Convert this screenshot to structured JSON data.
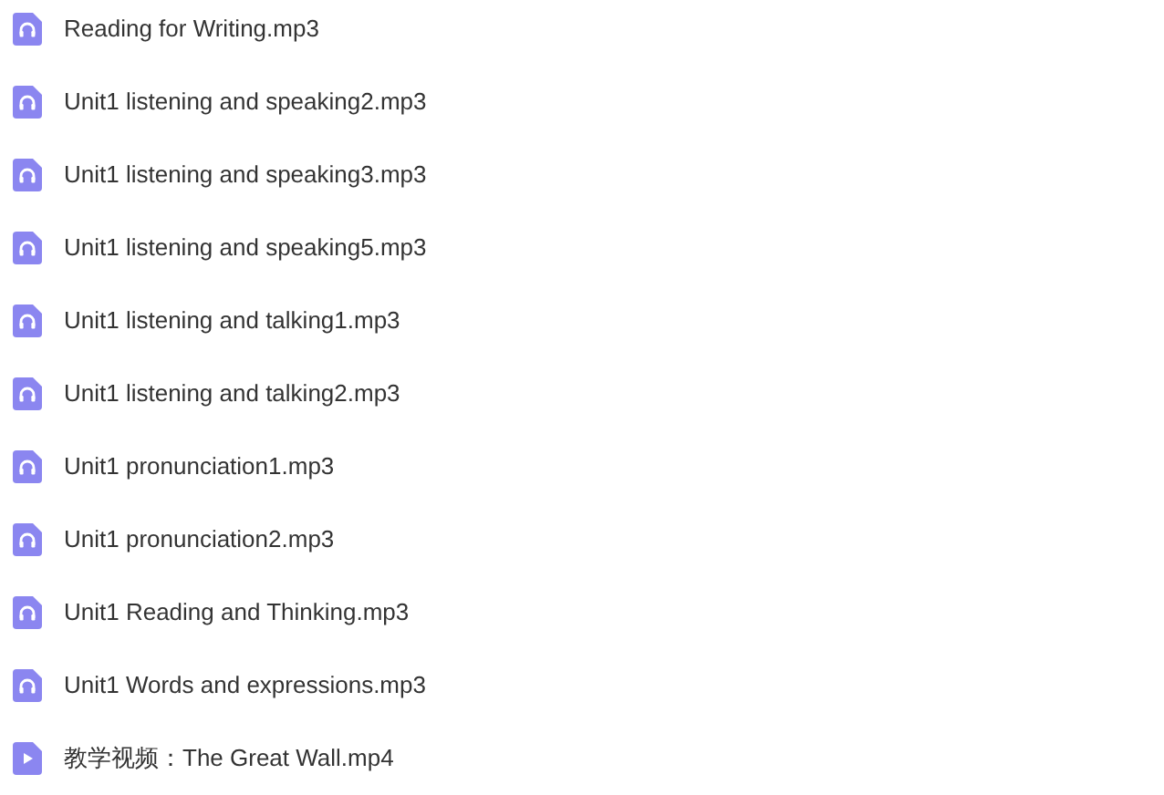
{
  "files": [
    {
      "kind": "audio",
      "name": "Reading for Writing.mp3"
    },
    {
      "kind": "audio",
      "name": "Unit1 listening and speaking2.mp3"
    },
    {
      "kind": "audio",
      "name": "Unit1 listening and speaking3.mp3"
    },
    {
      "kind": "audio",
      "name": "Unit1 listening and speaking5.mp3"
    },
    {
      "kind": "audio",
      "name": "Unit1 listening and talking1.mp3"
    },
    {
      "kind": "audio",
      "name": "Unit1 listening and talking2.mp3"
    },
    {
      "kind": "audio",
      "name": "Unit1 pronunciation1.mp3"
    },
    {
      "kind": "audio",
      "name": "Unit1 pronunciation2.mp3"
    },
    {
      "kind": "audio",
      "name": "Unit1 Reading and Thinking.mp3"
    },
    {
      "kind": "audio",
      "name": "Unit1 Words and expressions.mp3"
    },
    {
      "kind": "video",
      "name": "教学视频：The Great Wall.mp4"
    }
  ]
}
